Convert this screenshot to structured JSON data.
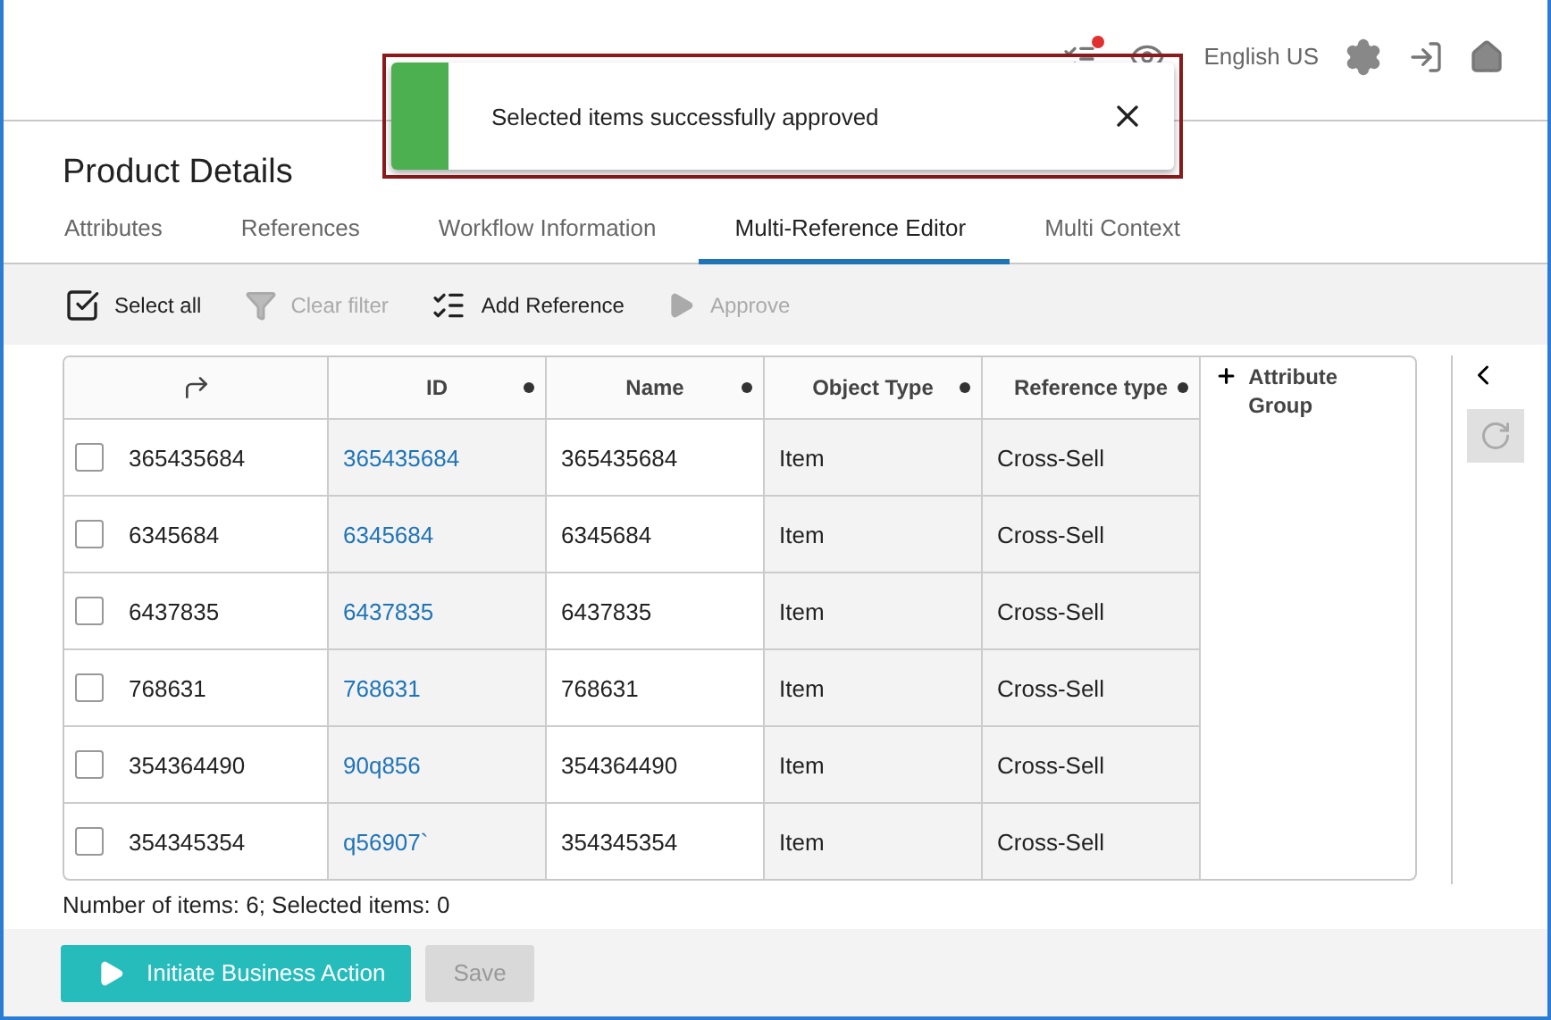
{
  "header": {
    "language": "English US"
  },
  "toast": {
    "message": "Selected items successfully approved"
  },
  "title": "Product Details",
  "tabs": [
    {
      "label": "Attributes",
      "selected": false
    },
    {
      "label": "References",
      "selected": false
    },
    {
      "label": "Workflow Information",
      "selected": false
    },
    {
      "label": "Multi-Reference Editor",
      "selected": true
    },
    {
      "label": "Multi Context",
      "selected": false
    }
  ],
  "toolbar": [
    {
      "kind": "select",
      "label": "Select all",
      "disabled": false
    },
    {
      "kind": "filter",
      "label": "Clear filter",
      "disabled": true
    },
    {
      "kind": "add",
      "label": "Add Reference",
      "disabled": false
    },
    {
      "kind": "approve",
      "label": "Approve",
      "disabled": true
    }
  ],
  "table": {
    "columns": [
      {
        "label": "ID",
        "shaded": true
      },
      {
        "label": "Name",
        "shaded": false
      },
      {
        "label": "Object Type",
        "shaded": true
      },
      {
        "label": "Reference type",
        "shaded": true
      }
    ],
    "add_column": "Attribute Group",
    "rows": [
      {
        "checked": false,
        "target": "365435684",
        "cells": [
          "365435684",
          "365435684",
          "Item",
          "Cross-Sell"
        ]
      },
      {
        "checked": false,
        "target": "6345684",
        "cells": [
          "6345684",
          "6345684",
          "Item",
          "Cross-Sell"
        ]
      },
      {
        "checked": false,
        "target": "6437835",
        "cells": [
          "6437835",
          "6437835",
          "Item",
          "Cross-Sell"
        ]
      },
      {
        "checked": false,
        "target": "768631",
        "cells": [
          "768631",
          "768631",
          "Item",
          "Cross-Sell"
        ]
      },
      {
        "checked": false,
        "target": "354364490",
        "cells": [
          "90q856",
          "354364490",
          "Item",
          "Cross-Sell"
        ]
      },
      {
        "checked": false,
        "target": "354345354",
        "cells": [
          "q56907`",
          "354345354",
          "Item",
          "Cross-Sell"
        ]
      }
    ]
  },
  "summary": "Number of items: 6; Selected items: 0",
  "footer": {
    "primary": "Initiate Business Action",
    "save": "Save",
    "save_disabled": true
  }
}
